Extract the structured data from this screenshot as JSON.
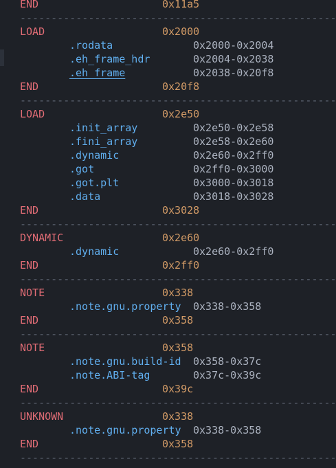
{
  "separator": "---------------------------------------------------",
  "lines": [
    {
      "type": "end",
      "kw": "END",
      "addr": "0x11a5"
    },
    {
      "type": "sep"
    },
    {
      "type": "seg",
      "kw": "LOAD",
      "addr": "0x2000"
    },
    {
      "type": "sec",
      "name": ".rodata",
      "range": "0x2000-0x2004"
    },
    {
      "type": "sec",
      "name": ".eh_frame_hdr",
      "range": "0x2004-0x2038"
    },
    {
      "type": "sec",
      "name": ".eh_frame",
      "range": "0x2038-0x20f8",
      "underline": true
    },
    {
      "type": "end",
      "kw": "END",
      "addr": "0x20f8"
    },
    {
      "type": "sep"
    },
    {
      "type": "seg",
      "kw": "LOAD",
      "addr": "0x2e50"
    },
    {
      "type": "sec",
      "name": ".init_array",
      "range": "0x2e50-0x2e58"
    },
    {
      "type": "sec",
      "name": ".fini_array",
      "range": "0x2e58-0x2e60"
    },
    {
      "type": "sec",
      "name": ".dynamic",
      "range": "0x2e60-0x2ff0"
    },
    {
      "type": "sec",
      "name": ".got",
      "range": "0x2ff0-0x3000"
    },
    {
      "type": "sec",
      "name": ".got.plt",
      "range": "0x3000-0x3018"
    },
    {
      "type": "sec",
      "name": ".data",
      "range": "0x3018-0x3028"
    },
    {
      "type": "end",
      "kw": "END",
      "addr": "0x3028"
    },
    {
      "type": "sep"
    },
    {
      "type": "seg",
      "kw": "DYNAMIC",
      "addr": "0x2e60"
    },
    {
      "type": "sec",
      "name": ".dynamic",
      "range": "0x2e60-0x2ff0"
    },
    {
      "type": "end",
      "kw": "END",
      "addr": "0x2ff0"
    },
    {
      "type": "sep"
    },
    {
      "type": "seg",
      "kw": "NOTE",
      "addr": "0x338"
    },
    {
      "type": "sec",
      "name": ".note.gnu.property",
      "range": "0x338-0x358"
    },
    {
      "type": "end",
      "kw": "END",
      "addr": "0x358"
    },
    {
      "type": "sep"
    },
    {
      "type": "seg",
      "kw": "NOTE",
      "addr": "0x358"
    },
    {
      "type": "sec",
      "name": ".note.gnu.build-id",
      "range": "0x358-0x37c"
    },
    {
      "type": "sec",
      "name": ".note.ABI-tag",
      "range": "0x37c-0x39c"
    },
    {
      "type": "end",
      "kw": "END",
      "addr": "0x39c"
    },
    {
      "type": "sep"
    },
    {
      "type": "seg",
      "kw": "UNKNOWN",
      "addr": "0x338"
    },
    {
      "type": "sec",
      "name": ".note.gnu.property",
      "range": "0x338-0x358"
    },
    {
      "type": "end",
      "kw": "END",
      "addr": "0x358"
    },
    {
      "type": "sep"
    }
  ]
}
